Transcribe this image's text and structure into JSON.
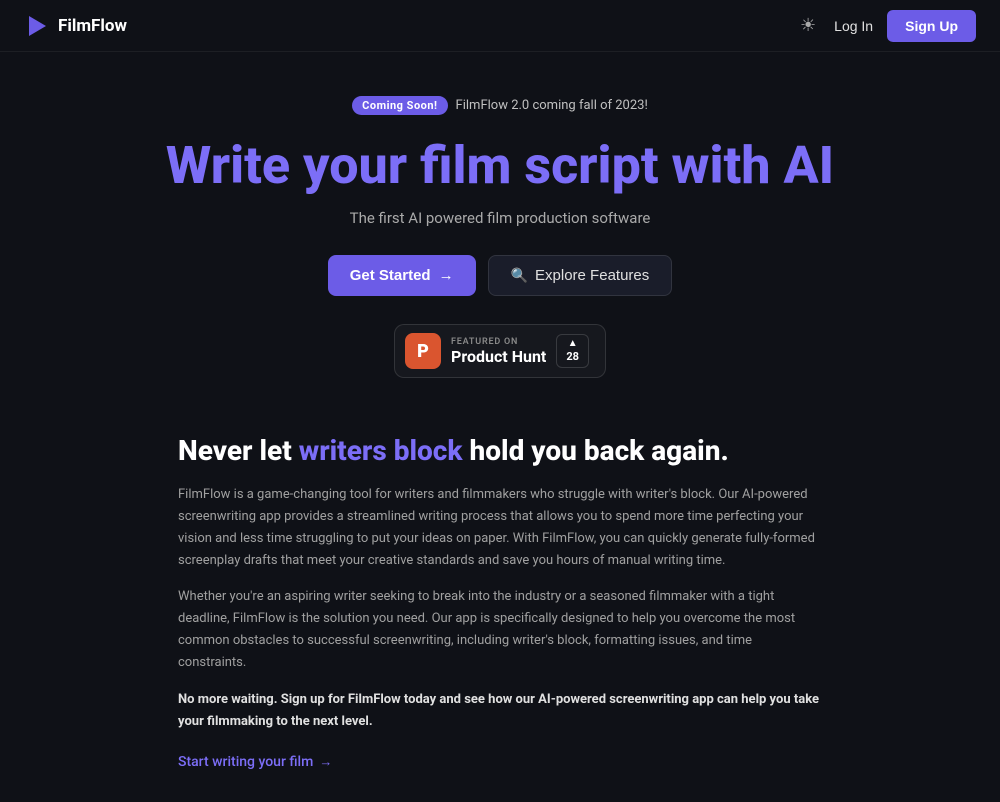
{
  "app": {
    "name": "FilmFlow"
  },
  "navbar": {
    "login_label": "Log In",
    "signup_label": "Sign Up",
    "theme_icon": "☀"
  },
  "hero": {
    "badge": "Coming Soon!",
    "announcement": "FilmFlow 2.0 coming fall of 2023!",
    "title": "Write your film script with AI",
    "subtitle": "The first AI powered film production software",
    "btn_get_started": "Get Started",
    "btn_explore": "Explore Features",
    "ph_featured_on": "FEATURED ON",
    "ph_name": "Product Hunt",
    "ph_upvote_count": "28"
  },
  "section": {
    "title_plain": "Never let ",
    "title_emphasis": "writers block",
    "title_rest": " hold you back again.",
    "para1": "FilmFlow is a game-changing tool for writers and filmmakers who struggle with writer's block. Our AI-powered screenwriting app provides a streamlined writing process that allows you to spend more time perfecting your vision and less time struggling to put your ideas on paper. With FilmFlow, you can quickly generate fully-formed screenplay drafts that meet your creative standards and save you hours of manual writing time.",
    "para2": "Whether you're an aspiring writer seeking to break into the industry or a seasoned filmmaker with a tight deadline, FilmFlow is the solution you need. Our app is specifically designed to help you overcome the most common obstacles to successful screenwriting, including writer's block, formatting issues, and time constraints.",
    "bold": "No more waiting. Sign up for FilmFlow today and see how our AI-powered screenwriting app can help you take your filmmaking to the next level.",
    "cta": "Start writing your film"
  }
}
